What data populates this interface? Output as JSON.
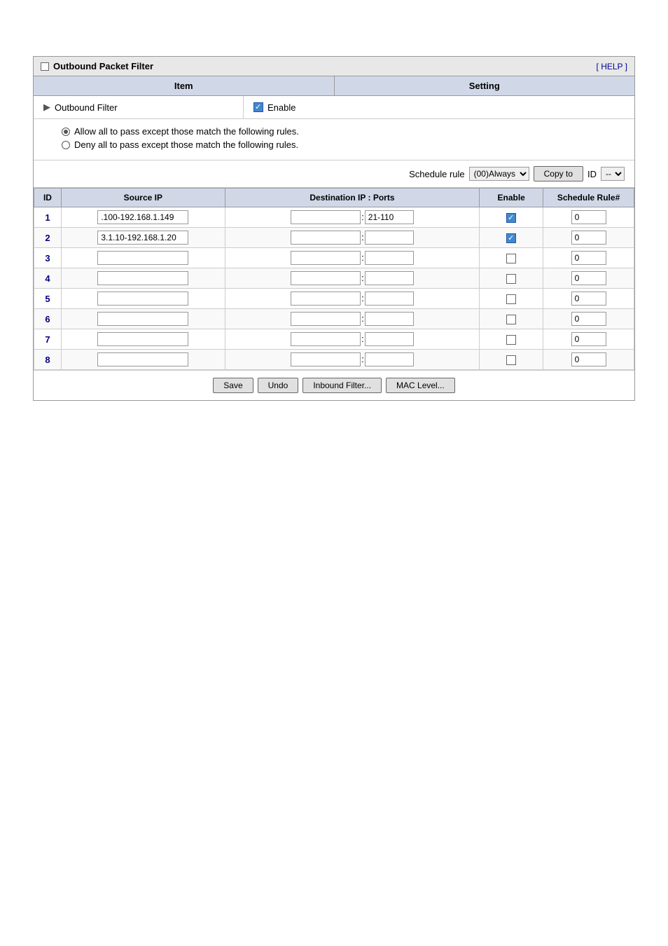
{
  "title": "Outbound Packet Filter",
  "help_label": "[ HELP ]",
  "headers": {
    "item": "Item",
    "setting": "Setting"
  },
  "outbound_filter_label": "Outbound Filter",
  "enable_label": "Enable",
  "radio1_label": "Allow all to pass except those match the following rules.",
  "radio2_label": "Deny all to pass except those match the following rules.",
  "schedule_rule_label": "Schedule rule",
  "schedule_always": "(00)Always",
  "copy_to_label": "Copy to",
  "id_label": "ID",
  "table_headers": {
    "id": "ID",
    "source_ip": "Source IP",
    "destination": "Destination IP : Ports",
    "enable": "Enable",
    "schedule_rule": "Schedule Rule#"
  },
  "rows": [
    {
      "id": 1,
      "source_ip": ".100-192.168.1.149",
      "dest_ip": "",
      "dest_port": "21-110",
      "enabled": true,
      "schedule": "0"
    },
    {
      "id": 2,
      "source_ip": "3.1.10-192.168.1.20",
      "dest_ip": "",
      "dest_port": "",
      "enabled": true,
      "schedule": "0"
    },
    {
      "id": 3,
      "source_ip": "",
      "dest_ip": "",
      "dest_port": "",
      "enabled": false,
      "schedule": "0"
    },
    {
      "id": 4,
      "source_ip": "",
      "dest_ip": "",
      "dest_port": "",
      "enabled": false,
      "schedule": "0"
    },
    {
      "id": 5,
      "source_ip": "",
      "dest_ip": "",
      "dest_port": "",
      "enabled": false,
      "schedule": "0"
    },
    {
      "id": 6,
      "source_ip": "",
      "dest_ip": "",
      "dest_port": "",
      "enabled": false,
      "schedule": "0"
    },
    {
      "id": 7,
      "source_ip": "",
      "dest_ip": "",
      "dest_port": "",
      "enabled": false,
      "schedule": "0"
    },
    {
      "id": 8,
      "source_ip": "",
      "dest_ip": "",
      "dest_port": "",
      "enabled": false,
      "schedule": "0"
    }
  ],
  "buttons": {
    "save": "Save",
    "undo": "Undo",
    "inbound_filter": "Inbound Filter...",
    "mac_level": "MAC Level..."
  },
  "id_dropdown_default": "--"
}
